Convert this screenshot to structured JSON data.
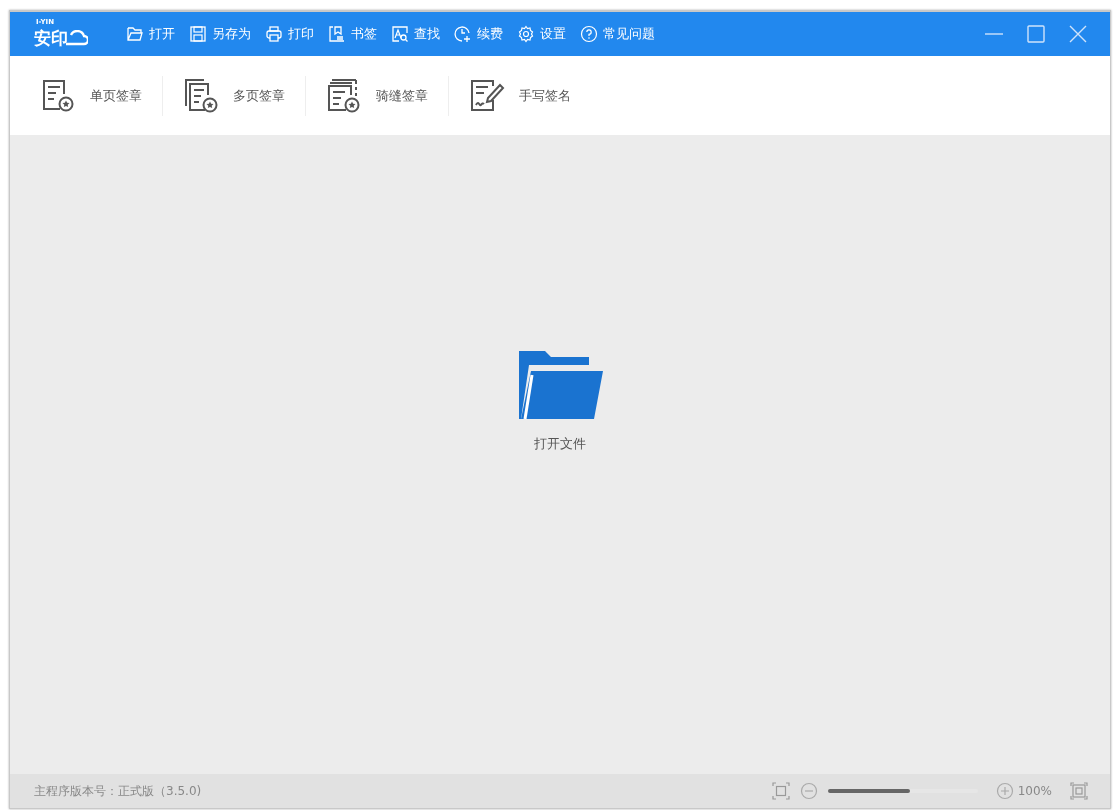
{
  "logo": {
    "small": "I-YIN",
    "main": "安印"
  },
  "menu": [
    {
      "label": "打开"
    },
    {
      "label": "另存为"
    },
    {
      "label": "打印"
    },
    {
      "label": "书签"
    },
    {
      "label": "查找"
    },
    {
      "label": "续费"
    },
    {
      "label": "设置"
    },
    {
      "label": "常见问题"
    }
  ],
  "toolbar": [
    {
      "label": "单页签章"
    },
    {
      "label": "多页签章"
    },
    {
      "label": "骑缝签章"
    },
    {
      "label": "手写签名"
    }
  ],
  "open_file": {
    "label": "打开文件"
  },
  "status_bar": {
    "version": "主程序版本号：正式版（3.5.0)",
    "zoom": {
      "level": 0.55,
      "reading": "100%"
    }
  }
}
